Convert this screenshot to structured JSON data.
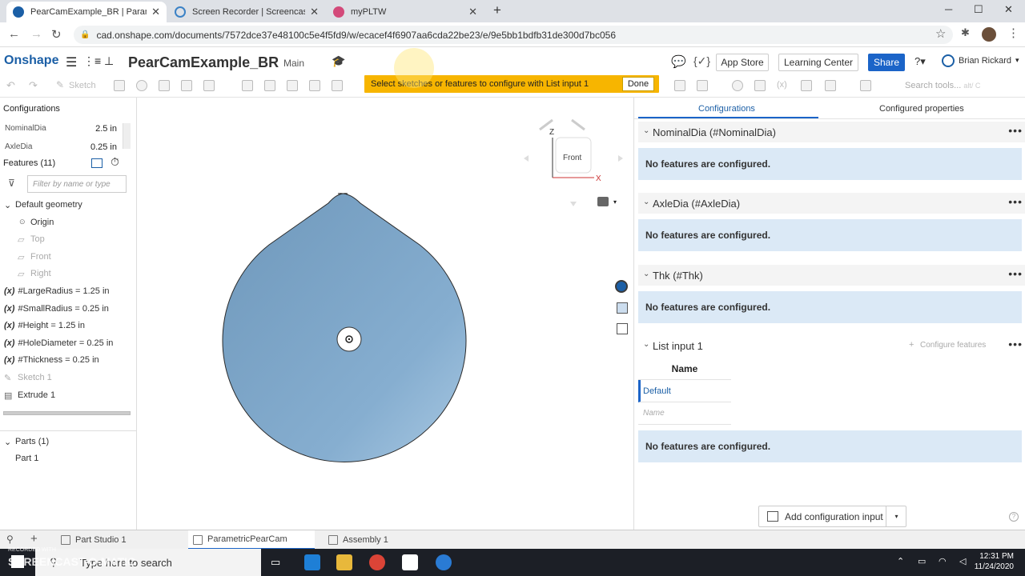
{
  "browser": {
    "tabs": [
      {
        "label": "PearCamExample_BR | Parametric",
        "active": true
      },
      {
        "label": "Screen Recorder | Screencast-O-",
        "active": false
      },
      {
        "label": "myPLTW",
        "active": false
      }
    ],
    "url": "cad.onshape.com/documents/7572dce37e48100c5e4f5fd9/w/ecacef4f6907aa6cda22be23/e/9e5bb1bdfb31de300d7bc056"
  },
  "header": {
    "logo": "Onshape",
    "doc_title": "PearCamExample_BR",
    "workspace": "Main",
    "app_store": "App Store",
    "learning_center": "Learning Center",
    "share": "Share",
    "user": "Brian Rickard"
  },
  "toolbar": {
    "sketch": "Sketch",
    "prompt": "Select sketches or features to configure with List input 1",
    "done": "Done",
    "search_placeholder": "Search tools...",
    "search_shortcut": "alt/ C"
  },
  "left_panel": {
    "configurations_title": "Configurations",
    "config_rows": [
      {
        "name": "NominalDia",
        "value": "2.5 in"
      },
      {
        "name": "AxleDia",
        "value": "0.25 in"
      }
    ],
    "features_title": "Features (11)",
    "filter_placeholder": "Filter by name or type",
    "default_geometry": "Default geometry",
    "geometry_items": [
      "Origin",
      "Top",
      "Front",
      "Right"
    ],
    "variables": [
      "#LargeRadius = 1.25 in",
      "#SmallRadius = 0.25 in",
      "#Height = 1.25 in",
      "#HoleDiameter = 0.25 in",
      "#Thickness = 0.25 in"
    ],
    "var_prefix": "(x)",
    "sketch": "Sketch 1",
    "extrude": "Extrude 1",
    "parts_title": "Parts (1)",
    "part": "Part 1"
  },
  "viewcube": {
    "face": "Front",
    "axis_z": "Z",
    "axis_x": "X"
  },
  "right_panel": {
    "tab_configurations": "Configurations",
    "tab_configured_properties": "Configured properties",
    "sections": [
      {
        "title": "NominalDia",
        "id": "(#NominalDia)",
        "message": "No features are configured."
      },
      {
        "title": "AxleDia",
        "id": "(#AxleDia)",
        "message": "No features are configured."
      },
      {
        "title": "Thk",
        "id": "(#Thk)",
        "message": "No features are configured."
      }
    ],
    "list_input": {
      "title": "List input 1",
      "configure_features": "Configure features",
      "column_name": "Name",
      "rows": [
        "Default"
      ],
      "new_row_placeholder": "Name",
      "message": "No features are configured."
    },
    "add_configuration_input": "Add configuration input"
  },
  "bottom_tabs": [
    "Part Studio 1",
    "ParametricPearCam",
    "Assembly 1"
  ],
  "taskbar": {
    "search": "Type here to search",
    "time": "12:31 PM",
    "date": "11/24/2020",
    "watermark": "SCREENCAST-O-MATIC",
    "watermark_small": "RECORDED WITH"
  },
  "colors": {
    "accent": "#1b64c8",
    "prompt_bar": "#f7b500",
    "part_fill": "#7aa3c3",
    "info_bg": "#dbe9f6"
  }
}
